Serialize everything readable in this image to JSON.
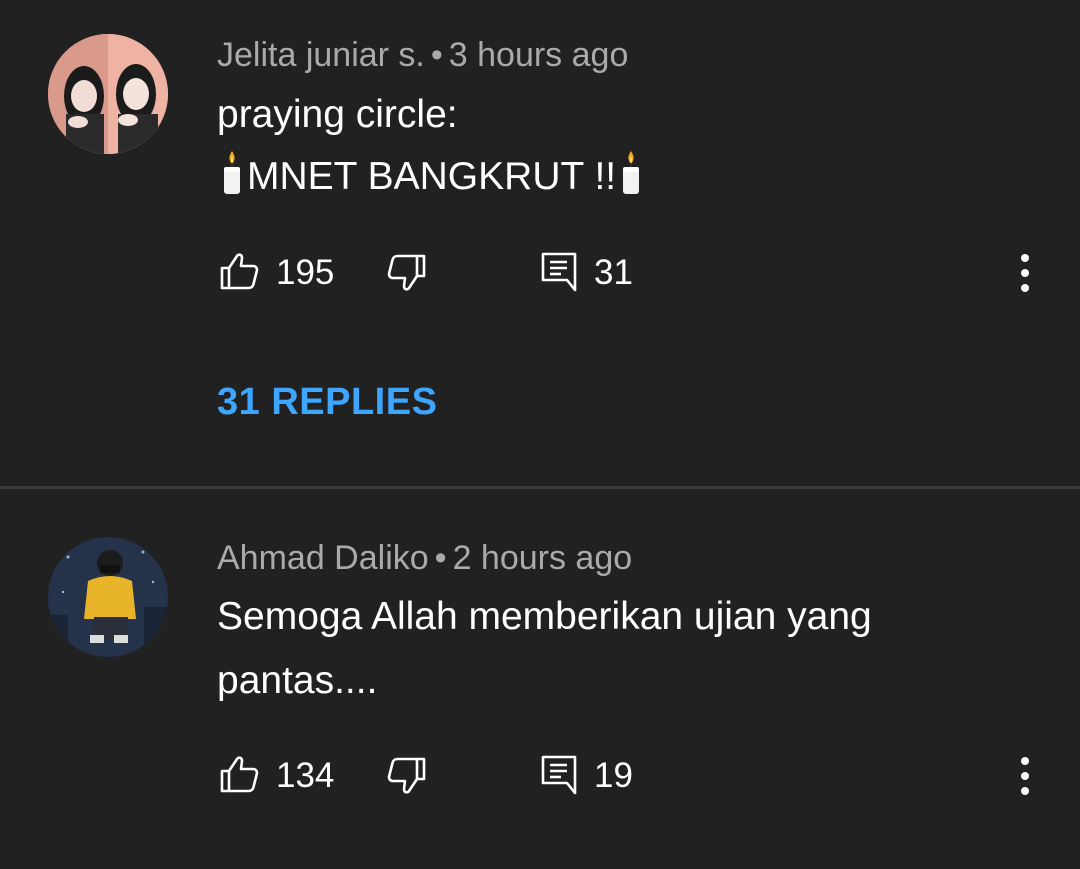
{
  "comments": [
    {
      "author": "Jelita juniar s.",
      "separator": "•",
      "time": "3 hours ago",
      "line1": "praying circle:",
      "line2_text": "MNET BANGKRUT !!",
      "likes": "195",
      "reply_count": "31",
      "replies_link": "31 REPLIES"
    },
    {
      "author": "Ahmad Daliko",
      "separator": "•",
      "time": "2 hours ago",
      "line1": "Semoga Allah memberikan ujian yang",
      "line2_text": "pantas....",
      "likes": "134",
      "reply_count": "19"
    }
  ],
  "icons": {
    "like": "thumbs-up-icon",
    "dislike": "thumbs-down-icon",
    "reply": "comment-icon",
    "more": "more-vertical-icon",
    "candle": "candle-icon"
  },
  "colors": {
    "background": "#212121",
    "meta_text": "#aaaaaa",
    "body_text": "#ffffff",
    "link": "#3ea6ff",
    "divider": "#3a3a3a"
  }
}
